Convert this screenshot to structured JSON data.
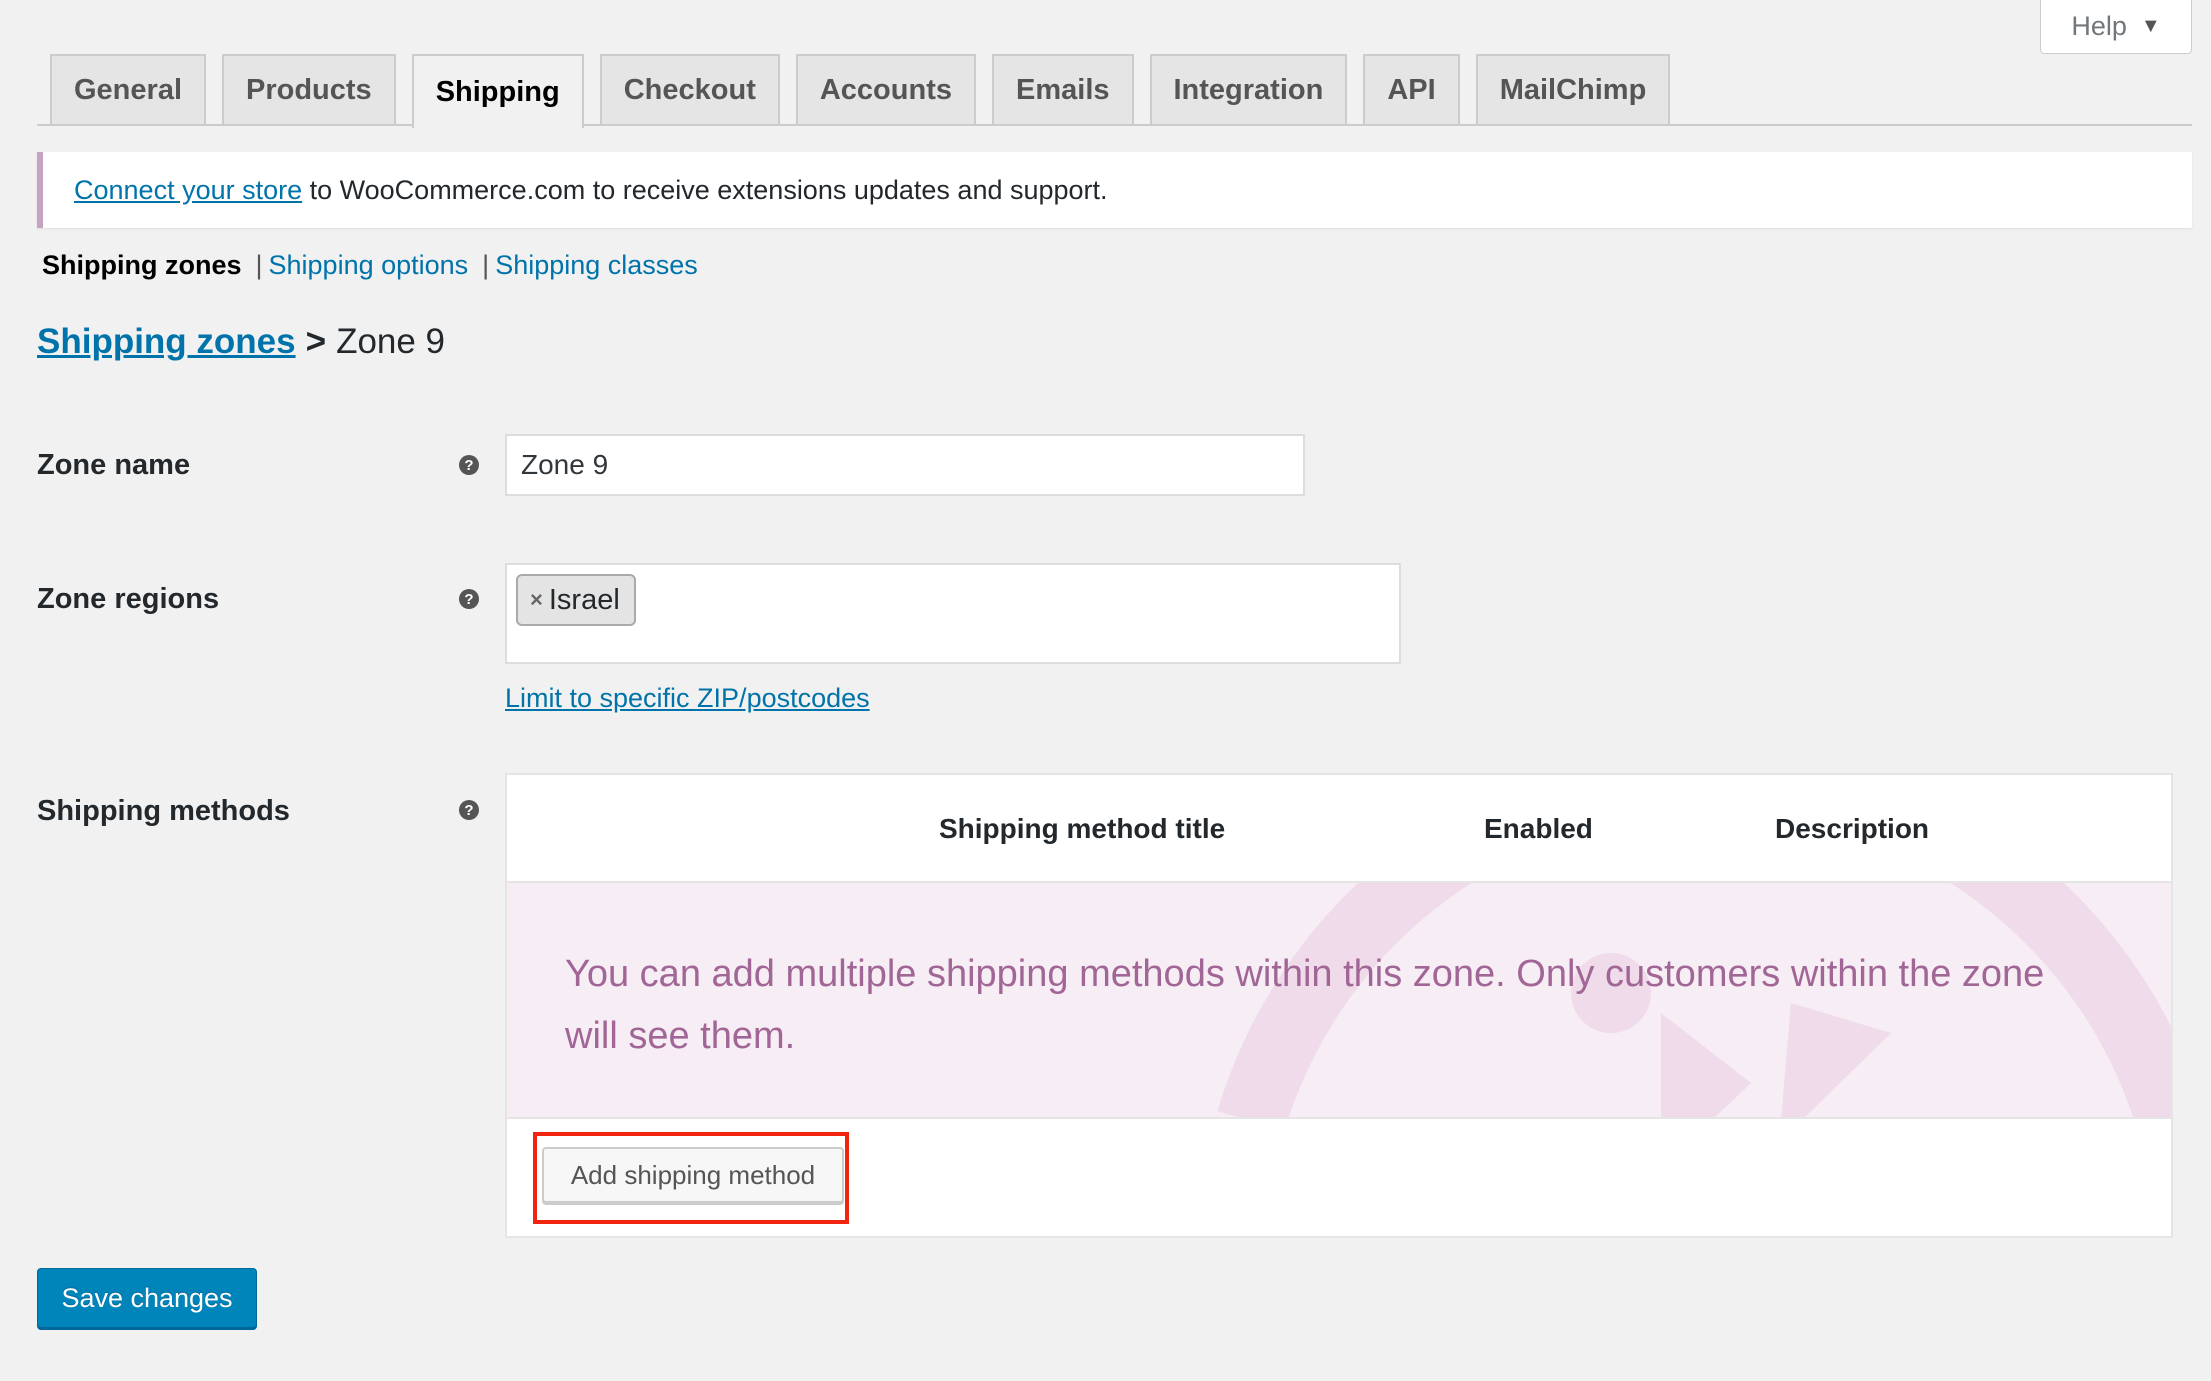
{
  "help": {
    "label": "Help",
    "caret": "▼"
  },
  "tabs": [
    {
      "label": "General",
      "active": false
    },
    {
      "label": "Products",
      "active": false
    },
    {
      "label": "Shipping",
      "active": true
    },
    {
      "label": "Checkout",
      "active": false
    },
    {
      "label": "Accounts",
      "active": false
    },
    {
      "label": "Emails",
      "active": false
    },
    {
      "label": "Integration",
      "active": false
    },
    {
      "label": "API",
      "active": false
    },
    {
      "label": "MailChimp",
      "active": false
    }
  ],
  "notice": {
    "link_text": "Connect your store",
    "text": " to WooCommerce.com to receive extensions updates and support."
  },
  "subnav": {
    "current": "Shipping zones",
    "separator": "|",
    "items": [
      "Shipping options",
      "Shipping classes"
    ]
  },
  "breadcrumb": {
    "parent": "Shipping zones",
    "separator": ">",
    "current": "Zone 9"
  },
  "form": {
    "help_tip": "?",
    "zone_name": {
      "label": "Zone name",
      "value": "Zone 9"
    },
    "zone_regions": {
      "label": "Zone regions",
      "chips": [
        {
          "remove": "×",
          "label": "Israel"
        }
      ],
      "limit_link": "Limit to specific ZIP/postcodes"
    },
    "shipping_methods": {
      "label": "Shipping methods",
      "columns": [
        "Shipping method title",
        "Enabled",
        "Description"
      ],
      "empty_text": "You can add multiple shipping methods within this zone. Only customers within the zone will see them.",
      "add_button": "Add shipping method"
    }
  },
  "save_button": "Save changes",
  "colors": {
    "link": "#0073aa",
    "primary_button": "#0085ba",
    "empty_state_bg": "#f7edf5",
    "empty_state_text": "#a16696",
    "highlight": "#f1250f",
    "notice_border": "#c7a3c2"
  },
  "icons": {
    "help_tip": "question-circle-icon",
    "chip_remove": "close-icon",
    "help_caret": "caret-down-icon",
    "watermark": "woocommerce-watermark-icon"
  }
}
